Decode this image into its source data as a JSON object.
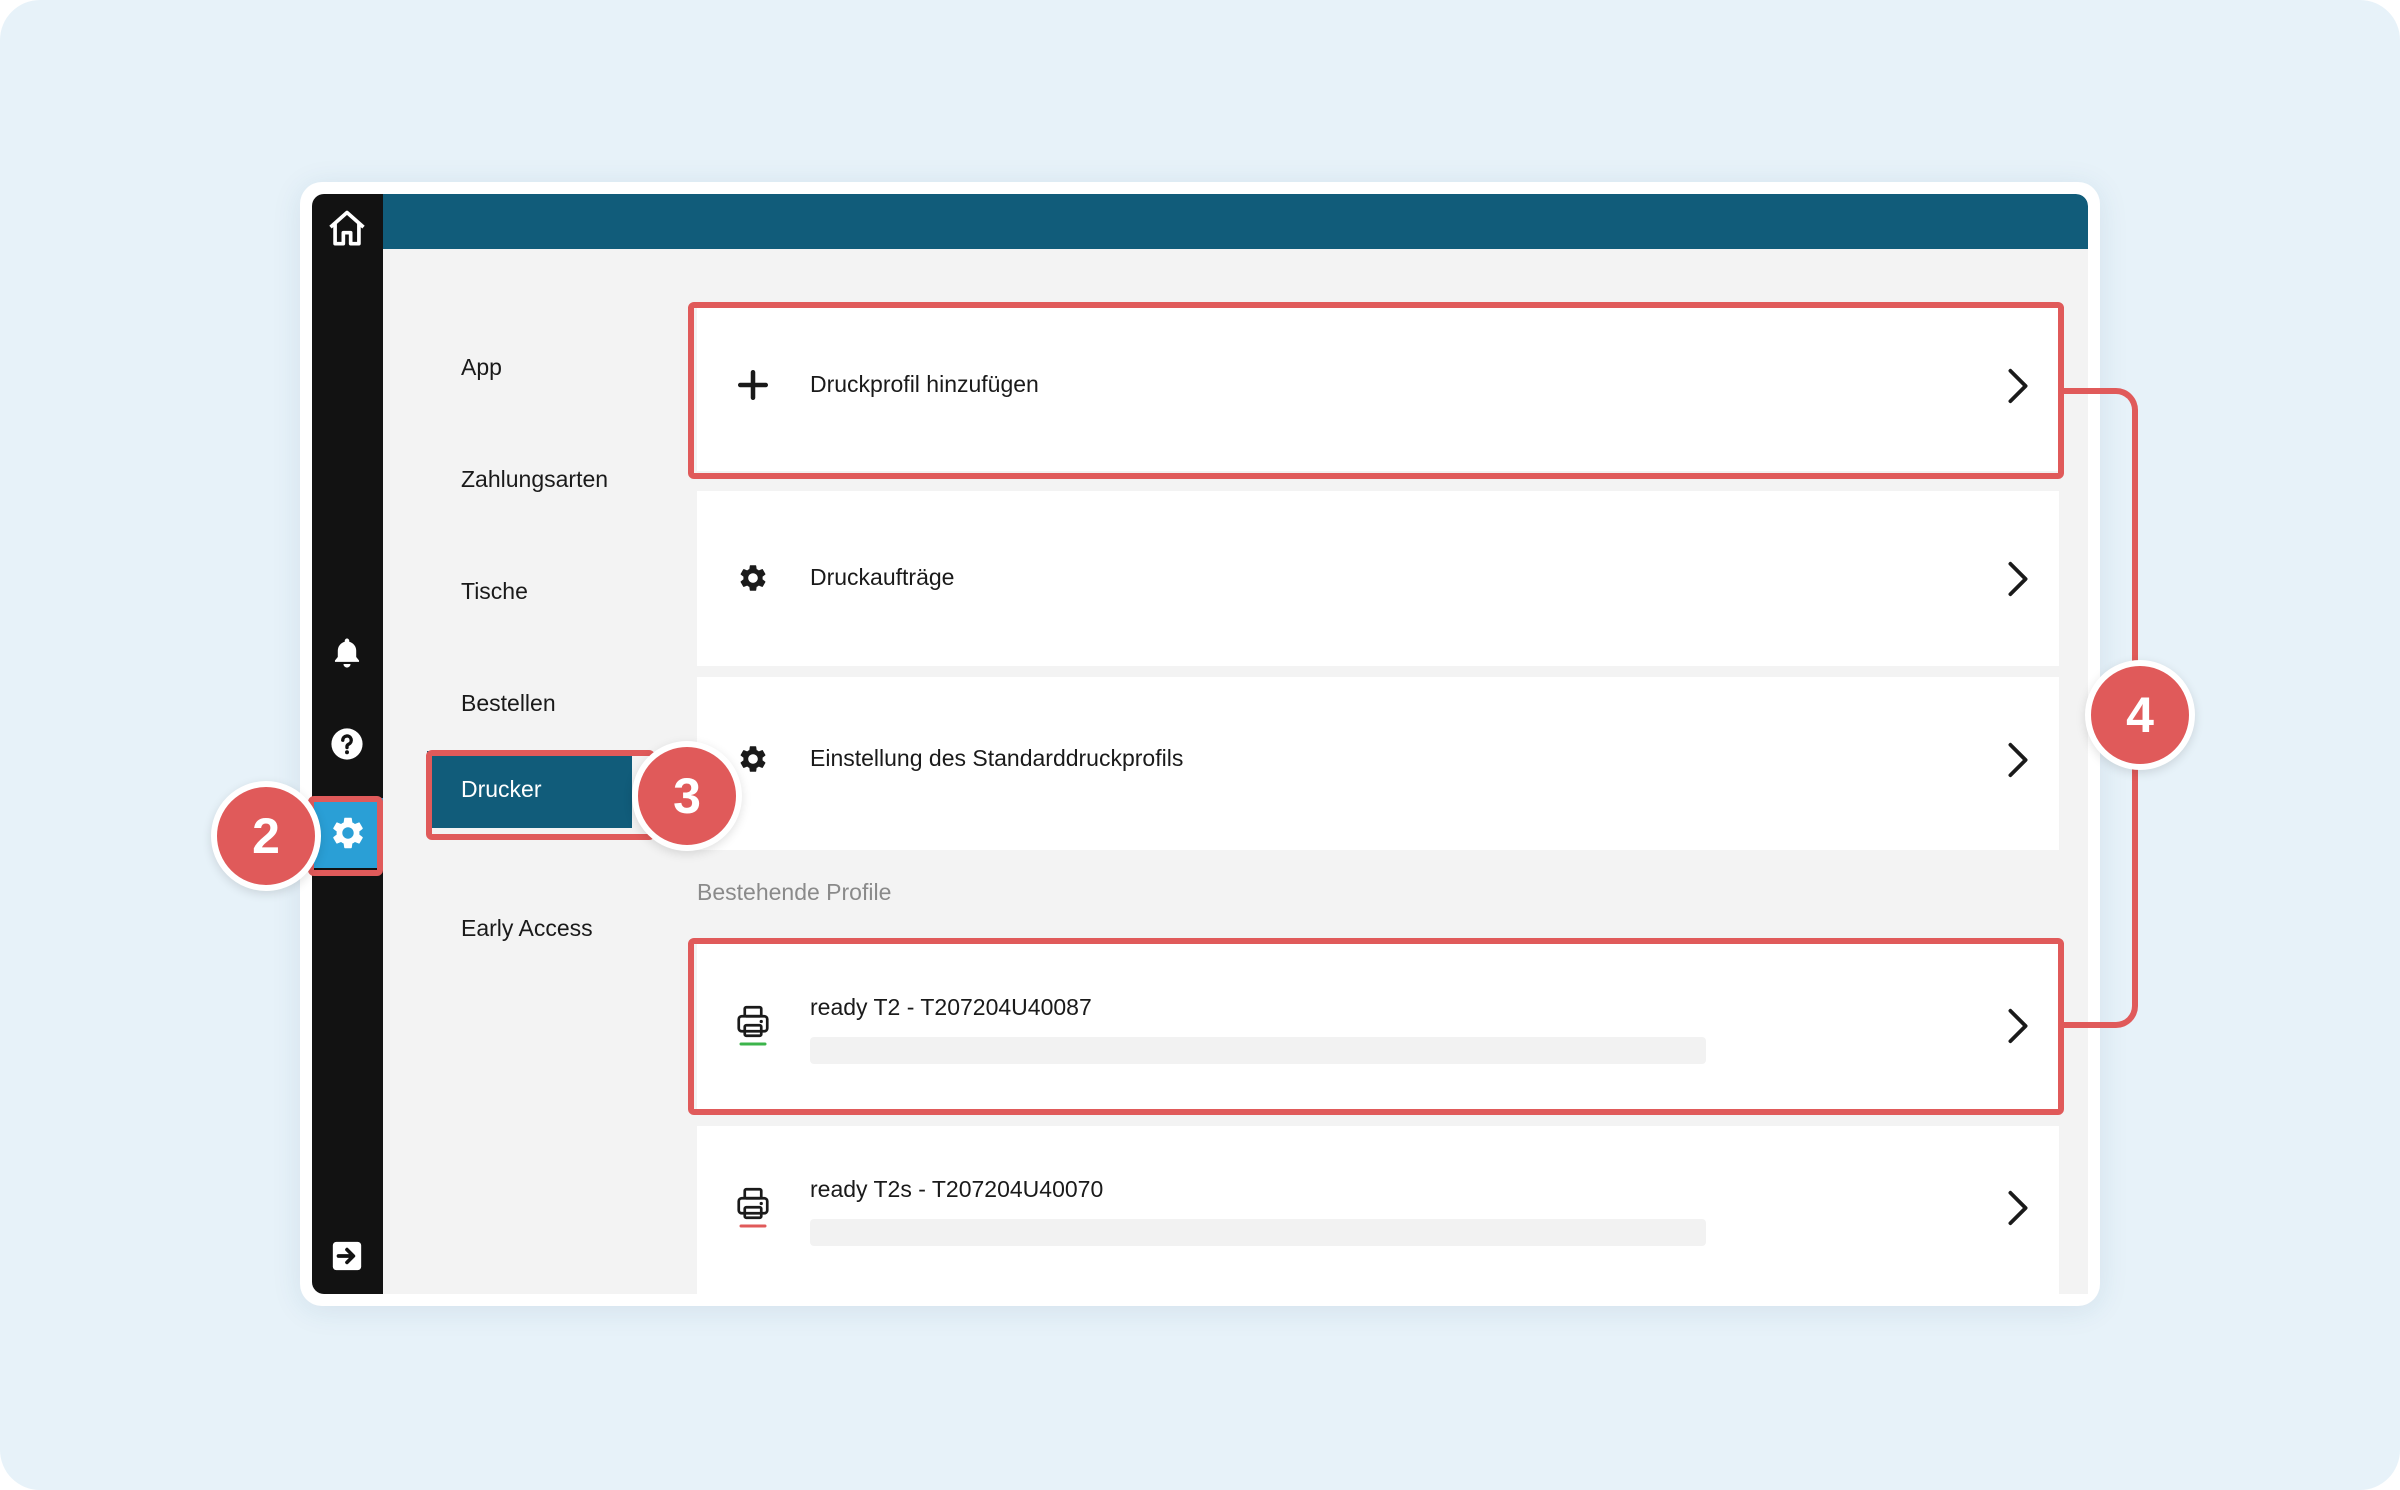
{
  "sidebar": {
    "icons": [
      "home-icon",
      "bell-icon",
      "help-icon",
      "gear-icon",
      "logout-icon"
    ]
  },
  "nav": {
    "items": [
      {
        "label": "App"
      },
      {
        "label": "Zahlungsarten"
      },
      {
        "label": "Tische"
      },
      {
        "label": "Bestellen"
      },
      {
        "label": "Drucker"
      },
      {
        "label": "Early Access"
      }
    ],
    "active": "Drucker"
  },
  "actions": {
    "add_profile": "Druckprofil hinzufügen",
    "print_jobs": "Druckaufträge",
    "default_settings": "Einstellung des Standarddruckprofils"
  },
  "profiles": {
    "section_label": "Bestehende Profile",
    "items": [
      {
        "name": "ready T2 - T207204U40087",
        "status_color": "#3cb44b"
      },
      {
        "name": "ready T2s - T207204U40070",
        "status_color": "#e05a5a"
      }
    ]
  },
  "annotations": {
    "badge_2": "2",
    "badge_3": "3",
    "badge_4": "4"
  },
  "colors": {
    "brand": "#115c7a",
    "sidebar": "#121212",
    "highlight": "#e05a5a",
    "settings_active": "#2a9fd6"
  }
}
